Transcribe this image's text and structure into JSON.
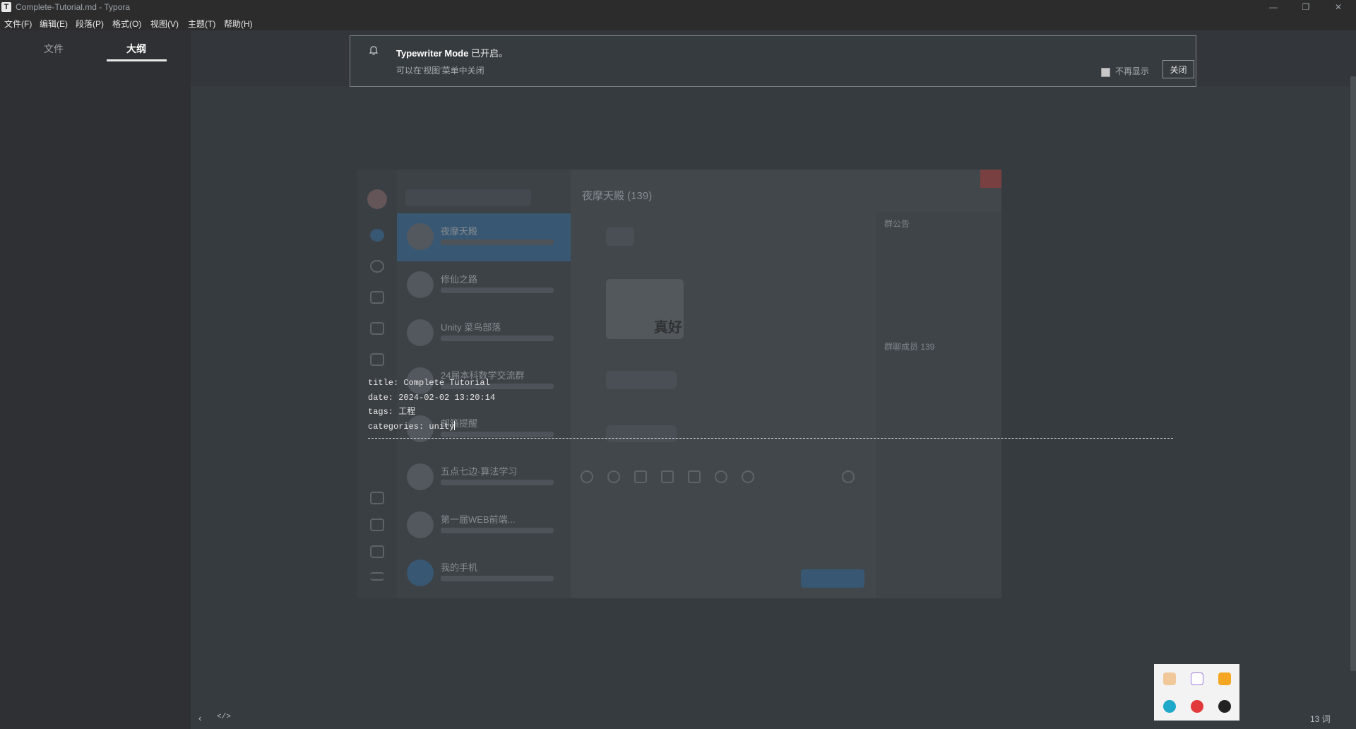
{
  "window": {
    "title": "Complete-Tutorial.md - Typora",
    "app_icon_letter": "T"
  },
  "menubar": {
    "items": [
      "文件(F)",
      "编辑(E)",
      "段落(P)",
      "格式(O)",
      "视图(V)",
      "主题(T)",
      "帮助(H)"
    ]
  },
  "sidebar": {
    "tabs": [
      "文件",
      "大纲"
    ],
    "active_tab": "大纲"
  },
  "notification": {
    "title_bold": "Typewriter Mode",
    "title_rest": " 已开启。",
    "subtitle": "可以在'视图'菜单中关闭",
    "checkbox_label": "不再显示",
    "close_button": "关闭"
  },
  "front_matter": {
    "lines": [
      "title: Complete Tutorial",
      "date: 2024-02-02 13:20:14",
      "tags: 工程",
      "categories: unity"
    ]
  },
  "embedded_image": {
    "chat_title": "夜摩天殿 (139)",
    "conversations": [
      {
        "name": "夜摩天殿",
        "selected": true
      },
      {
        "name": "修仙之路",
        "selected": false
      },
      {
        "name": "Unity 菜鸟部落",
        "selected": false
      },
      {
        "name": "24届本科数学交流群",
        "selected": false
      },
      {
        "name": "邮箱提醒",
        "selected": false
      },
      {
        "name": "五点七边·算法学习",
        "selected": false
      },
      {
        "name": "第一届WEB前端...",
        "selected": false
      },
      {
        "name": "我的手机",
        "selected": false
      }
    ],
    "panel_announcement": "群公告",
    "panel_members": "群聊成员 139",
    "sticker_text": "真好"
  },
  "status": {
    "word_count": "13 词"
  },
  "tray": {
    "icons": [
      "cat-app-icon",
      "p-app-icon",
      "orange-app-icon",
      "edge-icon",
      "netease-music-icon",
      "qq-icon"
    ]
  },
  "colors": {
    "editor_bg": "#363B40",
    "sidebar_bg": "#2E3033",
    "titlebar_bg": "#2C2C2C"
  }
}
